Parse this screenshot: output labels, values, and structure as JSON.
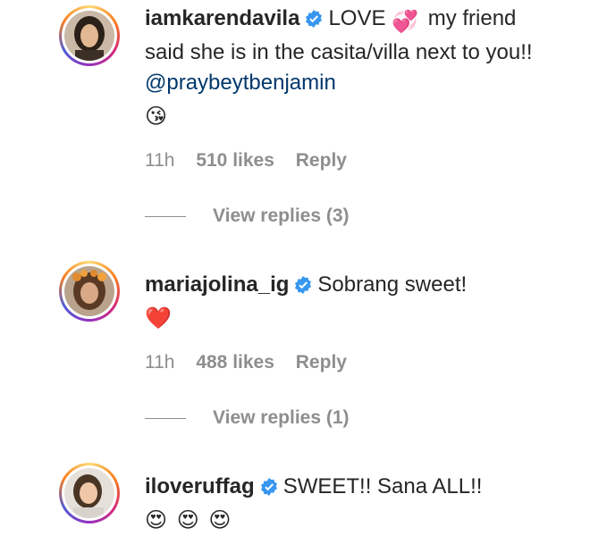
{
  "comments": [
    {
      "username": "iamkarendavila",
      "text_before": "LOVE",
      "text_after": " my friend said she is in the casita/villa next to you!!",
      "mention": "@praybeytbenjamin",
      "emoji": [
        "💞",
        "😘"
      ],
      "time": "11h",
      "likes": "510 likes",
      "reply": "Reply",
      "view_replies": "View replies (3)"
    },
    {
      "username": "mariajolina_ig",
      "text": "Sobrang sweet!",
      "emoji": [
        "❤️"
      ],
      "time": "11h",
      "likes": "488 likes",
      "reply": "Reply",
      "view_replies": "View replies (1)"
    },
    {
      "username": "iloveruffag",
      "text": "SWEET!! Sana ALL!!",
      "emoji": [
        "😍",
        "😍",
        "😍"
      ]
    }
  ],
  "colors": {
    "text": "#262626",
    "meta": "#8e8e8e",
    "mention": "#00376b",
    "verified": "#3897f0"
  }
}
